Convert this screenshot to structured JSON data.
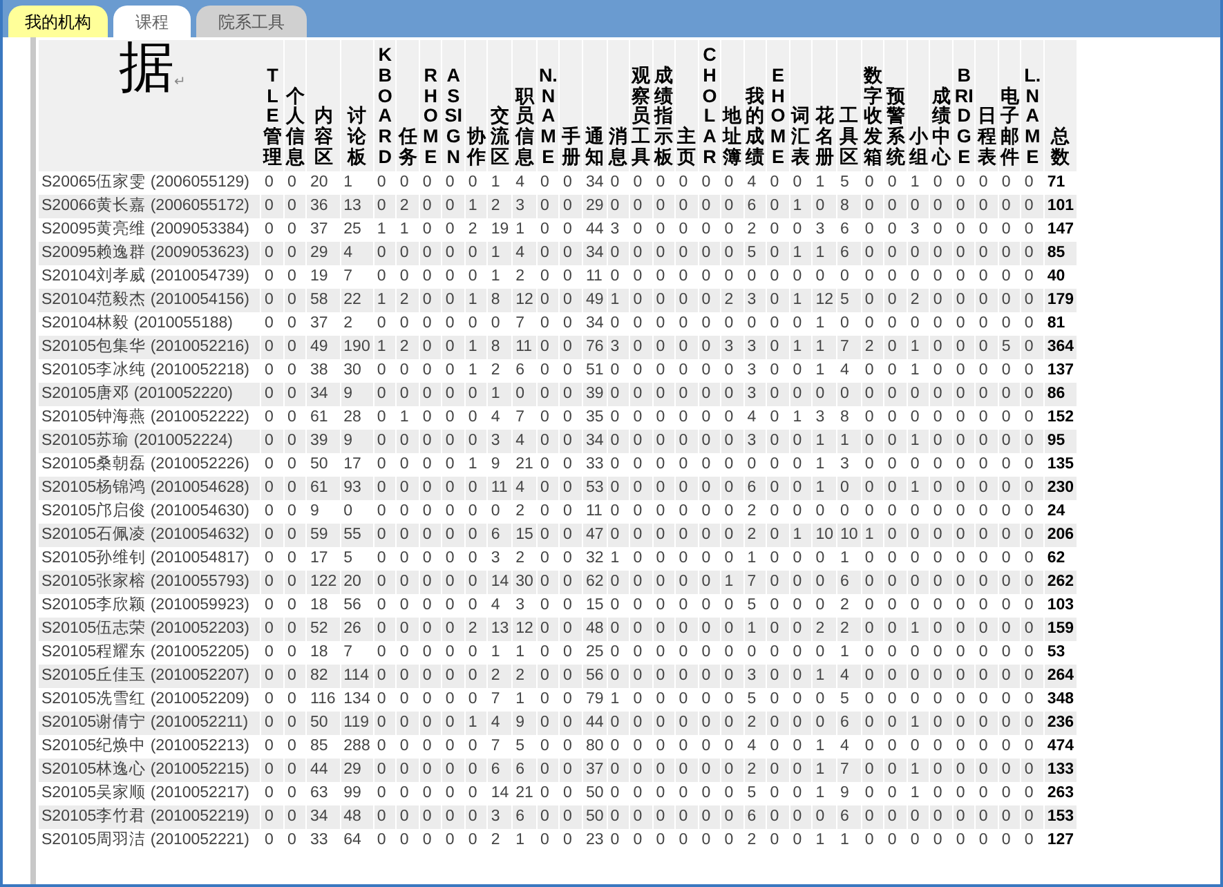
{
  "tabs": [
    {
      "label": "我的机构",
      "selected": true
    },
    {
      "label": "课程",
      "selected": false
    },
    {
      "label": "院系工具",
      "selected": false
    }
  ],
  "table": {
    "corner": {
      "text": "据",
      "mark": "↵"
    },
    "columns": [
      "TLE管理",
      "个人信息",
      "内容区",
      "讨论板",
      "KBOARD",
      "任务",
      "RHOME",
      "ASSIGN",
      "协作",
      "交流区",
      "职员信息",
      "N.NAME",
      "手册",
      "通知",
      "消息",
      "观察员工具",
      "成绩指示板",
      "主页",
      "CHOLAR",
      "地址簿",
      "我的成绩",
      "EHOME",
      "词汇表",
      "花名册",
      "工具区",
      "数字收发箱",
      "预警系统",
      "小组",
      "成绩中心",
      "BRIDGE",
      "日程表",
      "电子邮件",
      "L.NAME",
      "总数"
    ],
    "rows": [
      {
        "name": "S20065伍家雯 (2006055129)",
        "values": [
          "0",
          "0",
          "20",
          "1",
          "0",
          "0",
          "0",
          "0",
          "0",
          "1",
          "4",
          "0",
          "0",
          "34",
          "0",
          "0",
          "0",
          "0",
          "0",
          "0",
          "4",
          "0",
          "0",
          "1",
          "5",
          "0",
          "0",
          "1",
          "0",
          "0",
          "0",
          "0",
          "0",
          "71"
        ]
      },
      {
        "name": "S20066黄长嘉 (2006055172)",
        "values": [
          "0",
          "0",
          "36",
          "13",
          "0",
          "2",
          "0",
          "0",
          "1",
          "2",
          "3",
          "0",
          "0",
          "29",
          "0",
          "0",
          "0",
          "0",
          "0",
          "0",
          "6",
          "0",
          "1",
          "0",
          "8",
          "0",
          "0",
          "0",
          "0",
          "0",
          "0",
          "0",
          "0",
          "101"
        ]
      },
      {
        "name": "S20095黄亮维 (2009053384)",
        "values": [
          "0",
          "0",
          "37",
          "25",
          "1",
          "1",
          "0",
          "0",
          "2",
          "19",
          "1",
          "0",
          "0",
          "44",
          "3",
          "0",
          "0",
          "0",
          "0",
          "0",
          "2",
          "0",
          "0",
          "3",
          "6",
          "0",
          "0",
          "3",
          "0",
          "0",
          "0",
          "0",
          "0",
          "147"
        ]
      },
      {
        "name": "S20095赖逸群 (2009053623)",
        "values": [
          "0",
          "0",
          "29",
          "4",
          "0",
          "0",
          "0",
          "0",
          "0",
          "1",
          "4",
          "0",
          "0",
          "34",
          "0",
          "0",
          "0",
          "0",
          "0",
          "0",
          "5",
          "0",
          "1",
          "1",
          "6",
          "0",
          "0",
          "0",
          "0",
          "0",
          "0",
          "0",
          "0",
          "85"
        ]
      },
      {
        "name": "S20104刘孝威 (2010054739)",
        "values": [
          "0",
          "0",
          "19",
          "7",
          "0",
          "0",
          "0",
          "0",
          "0",
          "1",
          "2",
          "0",
          "0",
          "11",
          "0",
          "0",
          "0",
          "0",
          "0",
          "0",
          "0",
          "0",
          "0",
          "0",
          "0",
          "0",
          "0",
          "0",
          "0",
          "0",
          "0",
          "0",
          "0",
          "40"
        ]
      },
      {
        "name": "S20104范毅杰 (2010054156)",
        "values": [
          "0",
          "0",
          "58",
          "22",
          "1",
          "2",
          "0",
          "0",
          "1",
          "8",
          "12",
          "0",
          "0",
          "49",
          "1",
          "0",
          "0",
          "0",
          "0",
          "2",
          "3",
          "0",
          "1",
          "12",
          "5",
          "0",
          "0",
          "2",
          "0",
          "0",
          "0",
          "0",
          "0",
          "179"
        ]
      },
      {
        "name": "S20104林毅 (2010055188)",
        "values": [
          "0",
          "0",
          "37",
          "2",
          "0",
          "0",
          "0",
          "0",
          "0",
          "0",
          "7",
          "0",
          "0",
          "34",
          "0",
          "0",
          "0",
          "0",
          "0",
          "0",
          "0",
          "0",
          "0",
          "1",
          "0",
          "0",
          "0",
          "0",
          "0",
          "0",
          "0",
          "0",
          "0",
          "81"
        ]
      },
      {
        "name": "S20105包集华 (2010052216)",
        "values": [
          "0",
          "0",
          "49",
          "190",
          "1",
          "2",
          "0",
          "0",
          "1",
          "8",
          "11",
          "0",
          "0",
          "76",
          "3",
          "0",
          "0",
          "0",
          "0",
          "3",
          "3",
          "0",
          "1",
          "1",
          "7",
          "2",
          "0",
          "1",
          "0",
          "0",
          "0",
          "5",
          "0",
          "364"
        ]
      },
      {
        "name": "S20105李冰纯 (2010052218)",
        "values": [
          "0",
          "0",
          "38",
          "30",
          "0",
          "0",
          "0",
          "0",
          "1",
          "2",
          "6",
          "0",
          "0",
          "51",
          "0",
          "0",
          "0",
          "0",
          "0",
          "0",
          "3",
          "0",
          "0",
          "1",
          "4",
          "0",
          "0",
          "1",
          "0",
          "0",
          "0",
          "0",
          "0",
          "137"
        ]
      },
      {
        "name": "S20105唐邓 (2010052220)",
        "values": [
          "0",
          "0",
          "34",
          "9",
          "0",
          "0",
          "0",
          "0",
          "0",
          "1",
          "0",
          "0",
          "0",
          "39",
          "0",
          "0",
          "0",
          "0",
          "0",
          "0",
          "3",
          "0",
          "0",
          "0",
          "0",
          "0",
          "0",
          "0",
          "0",
          "0",
          "0",
          "0",
          "0",
          "86"
        ]
      },
      {
        "name": "S20105钟海燕 (2010052222)",
        "values": [
          "0",
          "0",
          "61",
          "28",
          "0",
          "1",
          "0",
          "0",
          "0",
          "4",
          "7",
          "0",
          "0",
          "35",
          "0",
          "0",
          "0",
          "0",
          "0",
          "0",
          "4",
          "0",
          "1",
          "3",
          "8",
          "0",
          "0",
          "0",
          "0",
          "0",
          "0",
          "0",
          "0",
          "152"
        ]
      },
      {
        "name": "S20105苏瑜 (2010052224)",
        "values": [
          "0",
          "0",
          "39",
          "9",
          "0",
          "0",
          "0",
          "0",
          "0",
          "3",
          "4",
          "0",
          "0",
          "34",
          "0",
          "0",
          "0",
          "0",
          "0",
          "0",
          "3",
          "0",
          "0",
          "1",
          "1",
          "0",
          "0",
          "1",
          "0",
          "0",
          "0",
          "0",
          "0",
          "95"
        ]
      },
      {
        "name": "S20105桑朝磊 (2010052226)",
        "values": [
          "0",
          "0",
          "50",
          "17",
          "0",
          "0",
          "0",
          "0",
          "1",
          "9",
          "21",
          "0",
          "0",
          "33",
          "0",
          "0",
          "0",
          "0",
          "0",
          "0",
          "0",
          "0",
          "0",
          "1",
          "3",
          "0",
          "0",
          "0",
          "0",
          "0",
          "0",
          "0",
          "0",
          "135"
        ]
      },
      {
        "name": "S20105杨锦鸿 (2010054628)",
        "values": [
          "0",
          "0",
          "61",
          "93",
          "0",
          "0",
          "0",
          "0",
          "0",
          "11",
          "4",
          "0",
          "0",
          "53",
          "0",
          "0",
          "0",
          "0",
          "0",
          "0",
          "6",
          "0",
          "0",
          "1",
          "0",
          "0",
          "0",
          "1",
          "0",
          "0",
          "0",
          "0",
          "0",
          "230"
        ]
      },
      {
        "name": "S20105邝启俊 (2010054630)",
        "values": [
          "0",
          "0",
          "9",
          "0",
          "0",
          "0",
          "0",
          "0",
          "0",
          "0",
          "2",
          "0",
          "0",
          "11",
          "0",
          "0",
          "0",
          "0",
          "0",
          "0",
          "2",
          "0",
          "0",
          "0",
          "0",
          "0",
          "0",
          "0",
          "0",
          "0",
          "0",
          "0",
          "0",
          "24"
        ]
      },
      {
        "name": "S20105石佩凌 (2010054632)",
        "values": [
          "0",
          "0",
          "59",
          "55",
          "0",
          "0",
          "0",
          "0",
          "0",
          "6",
          "15",
          "0",
          "0",
          "47",
          "0",
          "0",
          "0",
          "0",
          "0",
          "0",
          "2",
          "0",
          "1",
          "10",
          "10",
          "1",
          "0",
          "0",
          "0",
          "0",
          "0",
          "0",
          "0",
          "206"
        ]
      },
      {
        "name": "S20105孙维钊 (2010054817)",
        "values": [
          "0",
          "0",
          "17",
          "5",
          "0",
          "0",
          "0",
          "0",
          "0",
          "3",
          "2",
          "0",
          "0",
          "32",
          "1",
          "0",
          "0",
          "0",
          "0",
          "0",
          "1",
          "0",
          "0",
          "0",
          "1",
          "0",
          "0",
          "0",
          "0",
          "0",
          "0",
          "0",
          "0",
          "62"
        ]
      },
      {
        "name": "S20105张家榕 (2010055793)",
        "values": [
          "0",
          "0",
          "122",
          "20",
          "0",
          "0",
          "0",
          "0",
          "0",
          "14",
          "30",
          "0",
          "0",
          "62",
          "0",
          "0",
          "0",
          "0",
          "0",
          "1",
          "7",
          "0",
          "0",
          "0",
          "6",
          "0",
          "0",
          "0",
          "0",
          "0",
          "0",
          "0",
          "0",
          "262"
        ]
      },
      {
        "name": "S20105李欣颖 (2010059923)",
        "values": [
          "0",
          "0",
          "18",
          "56",
          "0",
          "0",
          "0",
          "0",
          "0",
          "4",
          "3",
          "0",
          "0",
          "15",
          "0",
          "0",
          "0",
          "0",
          "0",
          "0",
          "5",
          "0",
          "0",
          "0",
          "2",
          "0",
          "0",
          "0",
          "0",
          "0",
          "0",
          "0",
          "0",
          "103"
        ]
      },
      {
        "name": "S20105伍志荣 (2010052203)",
        "values": [
          "0",
          "0",
          "52",
          "26",
          "0",
          "0",
          "0",
          "0",
          "2",
          "13",
          "12",
          "0",
          "0",
          "48",
          "0",
          "0",
          "0",
          "0",
          "0",
          "0",
          "1",
          "0",
          "0",
          "2",
          "2",
          "0",
          "0",
          "1",
          "0",
          "0",
          "0",
          "0",
          "0",
          "159"
        ]
      },
      {
        "name": "S20105程耀东 (2010052205)",
        "values": [
          "0",
          "0",
          "18",
          "7",
          "0",
          "0",
          "0",
          "0",
          "0",
          "1",
          "1",
          "0",
          "0",
          "25",
          "0",
          "0",
          "0",
          "0",
          "0",
          "0",
          "0",
          "0",
          "0",
          "0",
          "1",
          "0",
          "0",
          "0",
          "0",
          "0",
          "0",
          "0",
          "0",
          "53"
        ]
      },
      {
        "name": "S20105丘佳玉 (2010052207)",
        "values": [
          "0",
          "0",
          "82",
          "114",
          "0",
          "0",
          "0",
          "0",
          "0",
          "2",
          "2",
          "0",
          "0",
          "56",
          "0",
          "0",
          "0",
          "0",
          "0",
          "0",
          "3",
          "0",
          "0",
          "1",
          "4",
          "0",
          "0",
          "0",
          "0",
          "0",
          "0",
          "0",
          "0",
          "264"
        ]
      },
      {
        "name": "S20105冼雪红 (2010052209)",
        "values": [
          "0",
          "0",
          "116",
          "134",
          "0",
          "0",
          "0",
          "0",
          "0",
          "7",
          "1",
          "0",
          "0",
          "79",
          "1",
          "0",
          "0",
          "0",
          "0",
          "0",
          "5",
          "0",
          "0",
          "0",
          "5",
          "0",
          "0",
          "0",
          "0",
          "0",
          "0",
          "0",
          "0",
          "348"
        ]
      },
      {
        "name": "S20105谢倩宁 (2010052211)",
        "values": [
          "0",
          "0",
          "50",
          "119",
          "0",
          "0",
          "0",
          "0",
          "1",
          "4",
          "9",
          "0",
          "0",
          "44",
          "0",
          "0",
          "0",
          "0",
          "0",
          "0",
          "2",
          "0",
          "0",
          "0",
          "6",
          "0",
          "0",
          "1",
          "0",
          "0",
          "0",
          "0",
          "0",
          "236"
        ]
      },
      {
        "name": "S20105纪焕中 (2010052213)",
        "values": [
          "0",
          "0",
          "85",
          "288",
          "0",
          "0",
          "0",
          "0",
          "0",
          "7",
          "5",
          "0",
          "0",
          "80",
          "0",
          "0",
          "0",
          "0",
          "0",
          "0",
          "4",
          "0",
          "0",
          "1",
          "4",
          "0",
          "0",
          "0",
          "0",
          "0",
          "0",
          "0",
          "0",
          "474"
        ]
      },
      {
        "name": "S20105林逸心 (2010052215)",
        "values": [
          "0",
          "0",
          "44",
          "29",
          "0",
          "0",
          "0",
          "0",
          "0",
          "6",
          "6",
          "0",
          "0",
          "37",
          "0",
          "0",
          "0",
          "0",
          "0",
          "0",
          "2",
          "0",
          "0",
          "1",
          "7",
          "0",
          "0",
          "1",
          "0",
          "0",
          "0",
          "0",
          "0",
          "133"
        ]
      },
      {
        "name": "S20105吴家顺 (2010052217)",
        "values": [
          "0",
          "0",
          "63",
          "99",
          "0",
          "0",
          "0",
          "0",
          "0",
          "14",
          "21",
          "0",
          "0",
          "50",
          "0",
          "0",
          "0",
          "0",
          "0",
          "0",
          "5",
          "0",
          "0",
          "1",
          "9",
          "0",
          "0",
          "1",
          "0",
          "0",
          "0",
          "0",
          "0",
          "263"
        ]
      },
      {
        "name": "S20105李竹君 (2010052219)",
        "values": [
          "0",
          "0",
          "34",
          "48",
          "0",
          "0",
          "0",
          "0",
          "0",
          "3",
          "6",
          "0",
          "0",
          "50",
          "0",
          "0",
          "0",
          "0",
          "0",
          "0",
          "6",
          "0",
          "0",
          "0",
          "6",
          "0",
          "0",
          "0",
          "0",
          "0",
          "0",
          "0",
          "0",
          "153"
        ]
      },
      {
        "name": "S20105周羽洁 (2010052221)",
        "values": [
          "0",
          "0",
          "33",
          "64",
          "0",
          "0",
          "0",
          "0",
          "0",
          "2",
          "1",
          "0",
          "0",
          "23",
          "0",
          "0",
          "0",
          "0",
          "0",
          "0",
          "2",
          "0",
          "0",
          "1",
          "1",
          "0",
          "0",
          "0",
          "0",
          "0",
          "0",
          "0",
          "0",
          "127"
        ]
      }
    ]
  }
}
